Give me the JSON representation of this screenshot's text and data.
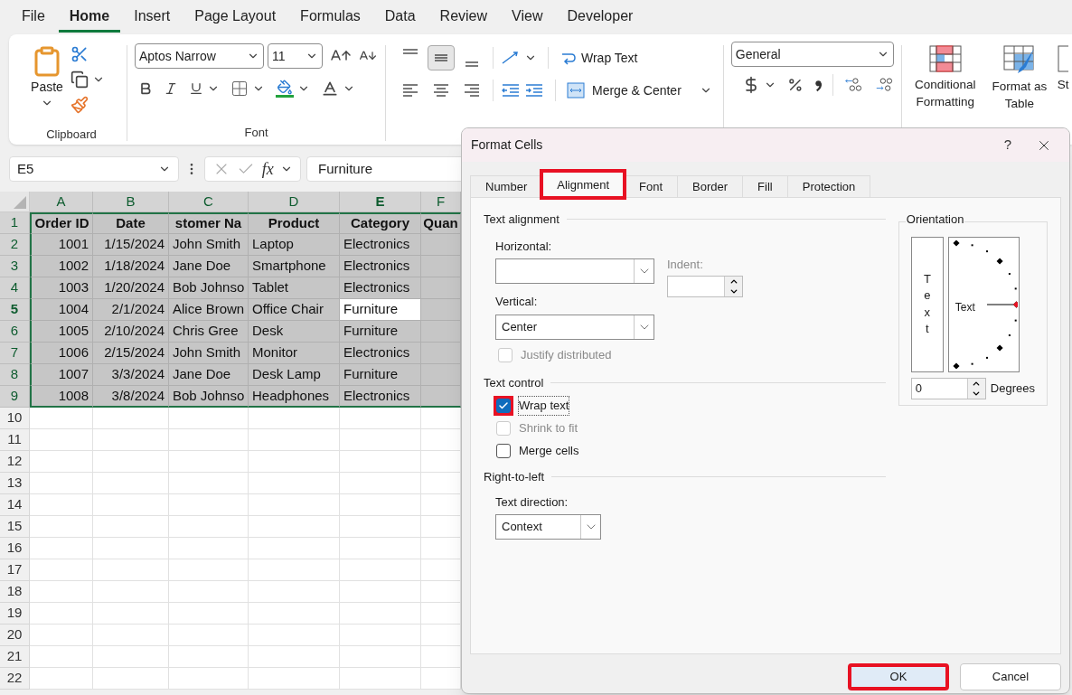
{
  "menu_tabs": [
    {
      "label": "File",
      "selected": false
    },
    {
      "label": "Home",
      "selected": true
    },
    {
      "label": "Insert",
      "selected": false
    },
    {
      "label": "Page Layout",
      "selected": false
    },
    {
      "label": "Formulas",
      "selected": false
    },
    {
      "label": "Data",
      "selected": false
    },
    {
      "label": "Review",
      "selected": false
    },
    {
      "label": "View",
      "selected": false
    },
    {
      "label": "Developer",
      "selected": false
    }
  ],
  "ribbon": {
    "clipboard": {
      "paste": "Paste",
      "label": "Clipboard"
    },
    "font": {
      "font_name": "Aptos Narrow",
      "font_size": "11",
      "label": "Font"
    },
    "alignment": {
      "vertical_buttons": [
        {
          "kind": "top",
          "selected": false
        },
        {
          "kind": "middle",
          "selected": true
        },
        {
          "kind": "bottom",
          "selected": false
        }
      ],
      "horizontal_buttons": [
        {
          "kind": "left",
          "selected": false
        },
        {
          "kind": "center",
          "selected": false
        },
        {
          "kind": "right",
          "selected": false
        }
      ],
      "wrap_text": "Wrap Text",
      "merge_center": "Merge & Center"
    },
    "number": {
      "format": "General"
    },
    "styles": [
      {
        "kind": "conditional",
        "label": "Conditional Formatting"
      },
      {
        "kind": "table",
        "label": "Format as Table"
      },
      {
        "kind": "cell",
        "label": "St"
      }
    ]
  },
  "formula_bar": {
    "name_box": "E5",
    "function_label": "fx",
    "value": "Furniture"
  },
  "sheet": {
    "columns": [
      {
        "letter": "A",
        "kind": "number",
        "active": false
      },
      {
        "letter": "B",
        "kind": "date",
        "active": false
      },
      {
        "letter": "C",
        "kind": "text",
        "active": false
      },
      {
        "letter": "D",
        "kind": "text",
        "active": false
      },
      {
        "letter": "E",
        "kind": "text",
        "active": true
      },
      {
        "letter": "F",
        "kind": "text",
        "active": false
      }
    ],
    "rows": [
      {
        "header": "1",
        "kind": "header",
        "selected": true,
        "active": false,
        "cells": [
          "Order ID",
          "Date",
          "stomer Na",
          "Product",
          "Category",
          "Quan"
        ]
      },
      {
        "header": "2",
        "kind": "data",
        "selected": true,
        "active": false,
        "cells": [
          "1001",
          "1/15/2024",
          "John Smith",
          "Laptop",
          "Electronics"
        ]
      },
      {
        "header": "3",
        "kind": "data",
        "selected": true,
        "active": false,
        "cells": [
          "1002",
          "1/18/2024",
          "Jane Doe",
          "Smartphone",
          "Electronics"
        ]
      },
      {
        "header": "4",
        "kind": "data",
        "selected": true,
        "active": false,
        "cells": [
          "1003",
          "1/20/2024",
          "Bob Johnso",
          "Tablet",
          "Electronics"
        ]
      },
      {
        "header": "5",
        "kind": "data",
        "selected": true,
        "active": true,
        "cells": [
          "1004",
          "2/1/2024",
          "Alice Brown",
          "Office Chair",
          "Furniture"
        ]
      },
      {
        "header": "6",
        "kind": "data",
        "selected": true,
        "active": false,
        "cells": [
          "1005",
          "2/10/2024",
          "Chris Gree",
          "Desk",
          "Furniture"
        ]
      },
      {
        "header": "7",
        "kind": "data",
        "selected": true,
        "active": false,
        "cells": [
          "1006",
          "2/15/2024",
          "John Smith",
          "Monitor",
          "Electronics"
        ]
      },
      {
        "header": "8",
        "kind": "data",
        "selected": true,
        "active": false,
        "cells": [
          "1007",
          "3/3/2024",
          "Jane Doe",
          "Desk Lamp",
          "Furniture"
        ]
      },
      {
        "header": "9",
        "kind": "data",
        "selected": true,
        "active": false,
        "cells": [
          "1008",
          "3/8/2024",
          "Bob Johnso",
          "Headphones",
          "Electronics"
        ]
      },
      {
        "header": "10",
        "kind": "data",
        "selected": false,
        "active": false
      },
      {
        "header": "11",
        "kind": "data",
        "selected": false,
        "active": false
      },
      {
        "header": "12",
        "kind": "data",
        "selected": false,
        "active": false
      },
      {
        "header": "13",
        "kind": "data",
        "selected": false,
        "active": false
      },
      {
        "header": "14",
        "kind": "data",
        "selected": false,
        "active": false
      },
      {
        "header": "15",
        "kind": "data",
        "selected": false,
        "active": false
      },
      {
        "header": "16",
        "kind": "data",
        "selected": false,
        "active": false
      },
      {
        "header": "17",
        "kind": "data",
        "selected": false,
        "active": false
      },
      {
        "header": "18",
        "kind": "data",
        "selected": false,
        "active": false
      },
      {
        "header": "19",
        "kind": "data",
        "selected": false,
        "active": false
      },
      {
        "header": "20",
        "kind": "data",
        "selected": false,
        "active": false
      },
      {
        "header": "21",
        "kind": "data",
        "selected": false,
        "active": false
      },
      {
        "header": "22",
        "kind": "data",
        "selected": false,
        "active": false
      }
    ]
  },
  "dialog": {
    "title": "Format Cells",
    "help": "?",
    "tabs": [
      {
        "label": "Number",
        "selected": false,
        "highlighted": false
      },
      {
        "label": "Alignment",
        "selected": true,
        "highlighted": true
      },
      {
        "label": "Font",
        "selected": false,
        "highlighted": false
      },
      {
        "label": "Border",
        "selected": false,
        "highlighted": false
      },
      {
        "label": "Fill",
        "selected": false,
        "highlighted": false
      },
      {
        "label": "Protection",
        "selected": false,
        "highlighted": false
      }
    ],
    "text_alignment": {
      "heading": "Text alignment",
      "horizontal_label": "Horizontal:",
      "indent_label": "Indent:",
      "vertical_label": "Vertical:",
      "vertical_value": "Center"
    },
    "justify_distributed": {
      "label": "Justify distributed",
      "checked": false,
      "disabled": true,
      "highlighted": false
    },
    "text_control": {
      "heading": "Text control",
      "options": [
        {
          "label": "Wrap text",
          "checked": true,
          "disabled": false,
          "highlighted": true
        },
        {
          "label": "Shrink to fit",
          "checked": false,
          "disabled": true,
          "highlighted": false
        },
        {
          "label": "Merge cells",
          "checked": false,
          "disabled": false,
          "highlighted": false
        }
      ]
    },
    "right_to_left": {
      "heading": "Right-to-left",
      "direction_label": "Text direction:",
      "direction_value": "Context"
    },
    "orientation": {
      "heading": "Orientation",
      "vertical_text": "Text",
      "dial_text": "Text",
      "degrees_value": "0",
      "degrees_label": "Degrees"
    },
    "buttons": [
      {
        "label": "OK",
        "highlighted": true
      },
      {
        "label": "Cancel",
        "highlighted": false
      }
    ]
  }
}
